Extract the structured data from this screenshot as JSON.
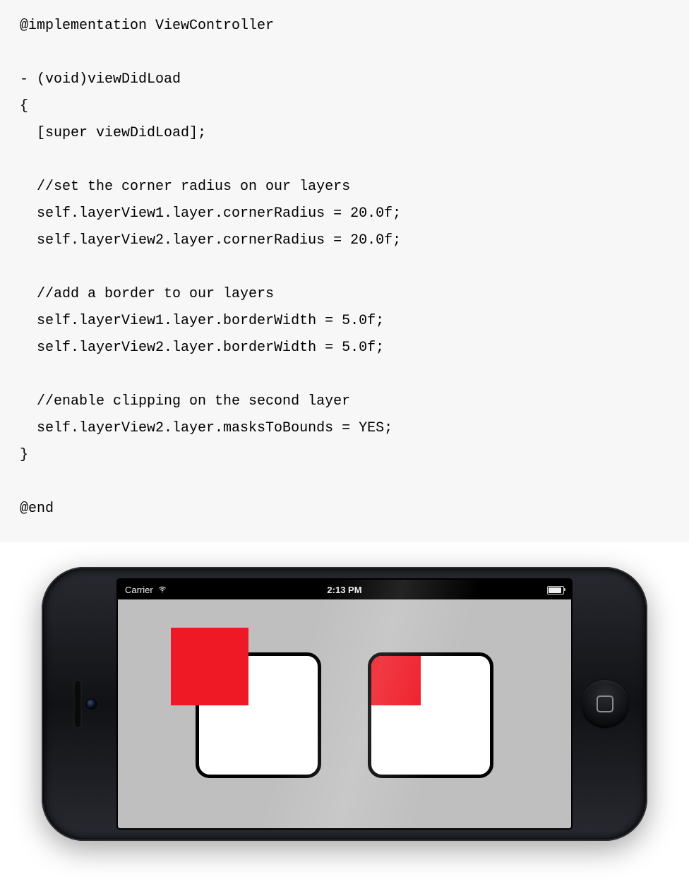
{
  "code": {
    "lines": [
      "@implementation ViewController",
      "",
      "- (void)viewDidLoad",
      "{",
      "  [super viewDidLoad];",
      "",
      "  //set the corner radius on our layers",
      "  self.layerView1.layer.cornerRadius = 20.0f;",
      "  self.layerView2.layer.cornerRadius = 20.0f;",
      "",
      "  //add a border to our layers",
      "  self.layerView1.layer.borderWidth = 5.0f;",
      "  self.layerView2.layer.borderWidth = 5.0f;",
      "",
      "  //enable clipping on the second layer",
      "  self.layerView2.layer.masksToBounds = YES;",
      "}",
      "",
      "@end"
    ]
  },
  "statusbar": {
    "carrier": "Carrier",
    "time": "2:13 PM"
  },
  "sim": {
    "cornerRadius": 20,
    "borderWidth": 5,
    "redColor": "#ee1925",
    "bgColor": "#bfbfbf",
    "layer1_masksToBounds": false,
    "layer2_masksToBounds": true
  }
}
